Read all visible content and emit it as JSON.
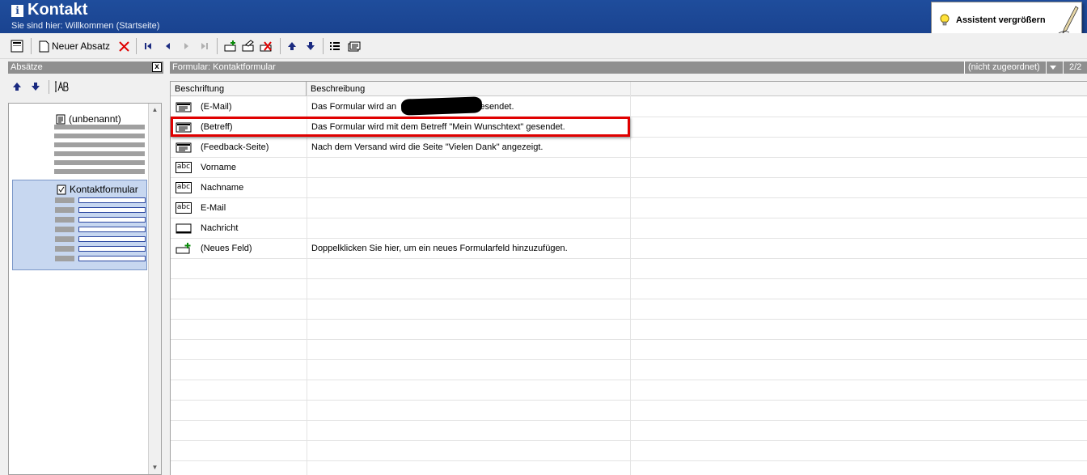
{
  "window": {
    "title": "Kontakt",
    "breadcrumb": "Sie sind hier: Willkommen (Startseite)",
    "assistant_label": "Assistent vergrößern"
  },
  "toolbar": {
    "new_paragraph_label": "Neuer Absatz",
    "icons": [
      "page-layout-icon",
      "new-paragraph-icon",
      "delete-icon",
      "first-icon",
      "prev-icon",
      "next-icon",
      "last-icon",
      "add-field-icon",
      "edit-field-icon",
      "delete-field-icon",
      "move-up-icon",
      "move-down-icon",
      "list-icon",
      "properties-icon"
    ]
  },
  "left_panel": {
    "header": "Absätze",
    "close_glyph": "x",
    "items": [
      {
        "label": "(unbenannt)",
        "type": "text-paragraph"
      },
      {
        "label": "Kontaktformular",
        "type": "form-paragraph",
        "selected": true
      }
    ]
  },
  "right_panel": {
    "header": "Formular: Kontaktformular",
    "assignment": "(nicht zugeordnet)",
    "page": "2/2"
  },
  "grid": {
    "columns": [
      "Beschriftung",
      "Beschreibung"
    ],
    "rows": [
      {
        "icon": "hidden-field-icon",
        "label": "(E-Mail)",
        "desc_before": "Das Formular wird an",
        "desc_after": "gesendet.",
        "redacted": true
      },
      {
        "icon": "hidden-field-icon",
        "label": "(Betreff)",
        "desc": "Das Formular wird mit dem Betreff \"Mein Wunschtext\" gesendet.",
        "highlighted": true
      },
      {
        "icon": "hidden-field-icon",
        "label": "(Feedback-Seite)",
        "desc": "Nach dem Versand wird die Seite \"Vielen Dank\" angezeigt."
      },
      {
        "icon": "text-field-icon",
        "label": "Vorname",
        "desc": ""
      },
      {
        "icon": "text-field-icon",
        "label": "Nachname",
        "desc": ""
      },
      {
        "icon": "text-field-icon",
        "label": "E-Mail",
        "desc": ""
      },
      {
        "icon": "textarea-field-icon",
        "label": "Nachricht",
        "desc": ""
      },
      {
        "icon": "add-field-icon",
        "label": "(Neues Feld)",
        "desc": "Doppelklicken Sie hier, um ein neues Formularfeld hinzuzufügen."
      }
    ],
    "text_field_icon_text": "abc"
  },
  "colors": {
    "titlebar": "#1a4390",
    "panel_header": "#8f8f8f",
    "selection": "#c7d7f0",
    "highlight": "#e00000"
  }
}
